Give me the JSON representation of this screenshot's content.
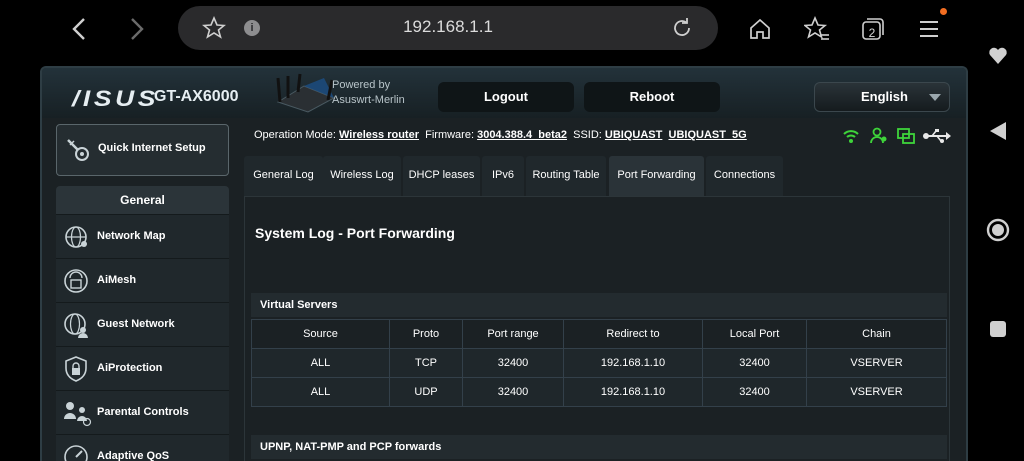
{
  "browser": {
    "url": "192.168.1.1",
    "tab_count": "2"
  },
  "header": {
    "brand": "/ISUS",
    "model": "GT-AX6000",
    "powered_by_line1": "Powered by",
    "powered_by_line2": "Asuswrt-Merlin",
    "logout_label": "Logout",
    "reboot_label": "Reboot",
    "language": "English"
  },
  "sidebar": {
    "quick_setup_label": "Quick Internet Setup",
    "general_header": "General",
    "items": [
      {
        "label": "Network Map",
        "icon": "globe-network-icon"
      },
      {
        "label": "AiMesh",
        "icon": "aimesh-icon"
      },
      {
        "label": "Guest Network",
        "icon": "guest-network-icon"
      },
      {
        "label": "AiProtection",
        "icon": "shield-lock-icon"
      },
      {
        "label": "Parental Controls",
        "icon": "family-icon"
      },
      {
        "label": "Adaptive QoS",
        "icon": "gauge-icon"
      }
    ]
  },
  "status": {
    "op_mode_label": "Operation Mode:",
    "op_mode_value": "Wireless router",
    "firmware_label": "Firmware:",
    "firmware_value": "3004.388.4_beta2",
    "ssid_label": "SSID:",
    "ssid_1": "UBIQUAST",
    "ssid_2": "UBIQUAST_5G"
  },
  "tabs": [
    {
      "label": "General Log"
    },
    {
      "label": "Wireless Log"
    },
    {
      "label": "DHCP leases"
    },
    {
      "label": "IPv6"
    },
    {
      "label": "Routing Table"
    },
    {
      "label": "Port Forwarding"
    },
    {
      "label": "Connections"
    }
  ],
  "content": {
    "title": "System Log - Port Forwarding",
    "virtual_servers": {
      "header": "Virtual Servers",
      "columns": [
        "Source",
        "Proto",
        "Port range",
        "Redirect to",
        "Local Port",
        "Chain"
      ],
      "rows": [
        [
          "ALL",
          "TCP",
          "32400",
          "192.168.1.10",
          "32400",
          "VSERVER"
        ],
        [
          "ALL",
          "UDP",
          "32400",
          "192.168.1.10",
          "32400",
          "VSERVER"
        ]
      ]
    },
    "upnp_header": "UPNP, NAT-PMP and PCP forwards"
  },
  "colors": {
    "accent_green": "#3ed43a",
    "background": "#1b2124",
    "notification_dot": "#f26d21"
  }
}
